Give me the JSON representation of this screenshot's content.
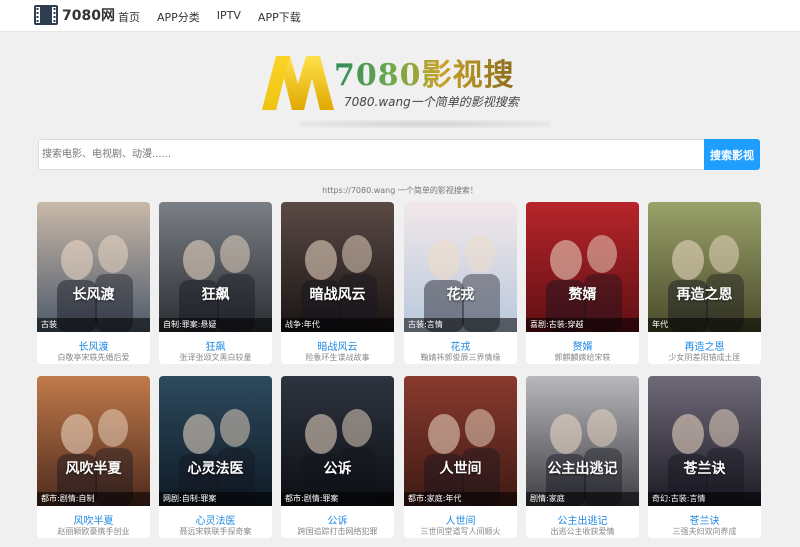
{
  "header": {
    "brand": "7080网",
    "brand_icon": "film-icon",
    "nav": [
      "首页",
      "APP分类",
      "IPTV",
      "APP下载"
    ]
  },
  "hero": {
    "title": "7080影视搜",
    "subtitle": "7080.wang一个简单的影视搜索"
  },
  "search": {
    "placeholder": "搜索电影、电视剧、动漫......",
    "button": "搜索影视"
  },
  "tagline": "https://7080.wang 一个简单的影视搜索！",
  "colors": {
    "accent": "#1e9fff",
    "title_link": "#1e88e5",
    "logo_yellow": "#f5c400"
  },
  "movies": [
    {
      "tags": "古装",
      "title": "长风渡",
      "desc": "白敬亭宋轶先婚后爱",
      "poster_text": "长风渡",
      "bg": [
        "#c9b8a8",
        "#4d5a6b"
      ]
    },
    {
      "tags": "自制:罪案:悬疑",
      "title": "狂飙",
      "desc": "张译张颂文黑白较量",
      "poster_text": "狂飙",
      "bg": [
        "#7a7f85",
        "#2b2e32"
      ]
    },
    {
      "tags": "战争:年代",
      "title": "暗战风云",
      "desc": "险象环生谍战故事",
      "poster_text": "暗战风云",
      "bg": [
        "#5a4a45",
        "#1a1414"
      ]
    },
    {
      "tags": "古装:言情",
      "title": "花戎",
      "desc": "鞠婧祎郭俊辰三界情缘",
      "poster_text": "花戎",
      "bg": [
        "#f2e8ea",
        "#b8c8dc"
      ]
    },
    {
      "tags": "喜剧:古装:穿越",
      "title": "赘婿",
      "desc": "郭麒麟嫁给宋轶",
      "poster_text": "赘婿",
      "bg": [
        "#b8252a",
        "#5e0f13"
      ]
    },
    {
      "tags": "年代",
      "title": "再造之恩",
      "desc": "少女阴差阳错成土匪",
      "poster_text": "再造之恩",
      "bg": [
        "#9aa26a",
        "#4a4a2a"
      ]
    },
    {
      "tags": "都市:剧情:自制",
      "title": "风吹半夏",
      "desc": "赵丽颖欧豪携手创业",
      "poster_text": "风吹半夏",
      "bg": [
        "#c07a4a",
        "#4e2a1e"
      ]
    },
    {
      "tags": "网剧:自制:罪案",
      "title": "心灵法医",
      "desc": "聂远宋轶联手探奇案",
      "poster_text": "心灵法医",
      "bg": [
        "#2e4a5e",
        "#0e1a24"
      ]
    },
    {
      "tags": "都市:剧情:罪案",
      "title": "公诉",
      "desc": "跨国追踪打击网络犯罪",
      "poster_text": "公诉",
      "bg": [
        "#2e3440",
        "#0c0e12"
      ]
    },
    {
      "tags": "都市:家庭:年代",
      "title": "人世间",
      "desc": "三世同堂道写人间顺火",
      "poster_text": "人世间",
      "bg": [
        "#8a3a2e",
        "#3e1a14"
      ]
    },
    {
      "tags": "剧情:家庭",
      "title": "公主出逃记",
      "desc": "出逃公主收获爱情",
      "poster_text": "公主出逃记",
      "bg": [
        "#b8b8bc",
        "#3e3e44"
      ]
    },
    {
      "tags": "奇幻:古装:言情",
      "title": "苍兰诀",
      "desc": "三强夫妇双向养成",
      "poster_text": "苍兰诀",
      "bg": [
        "#6e6a78",
        "#1e1a24"
      ]
    }
  ]
}
